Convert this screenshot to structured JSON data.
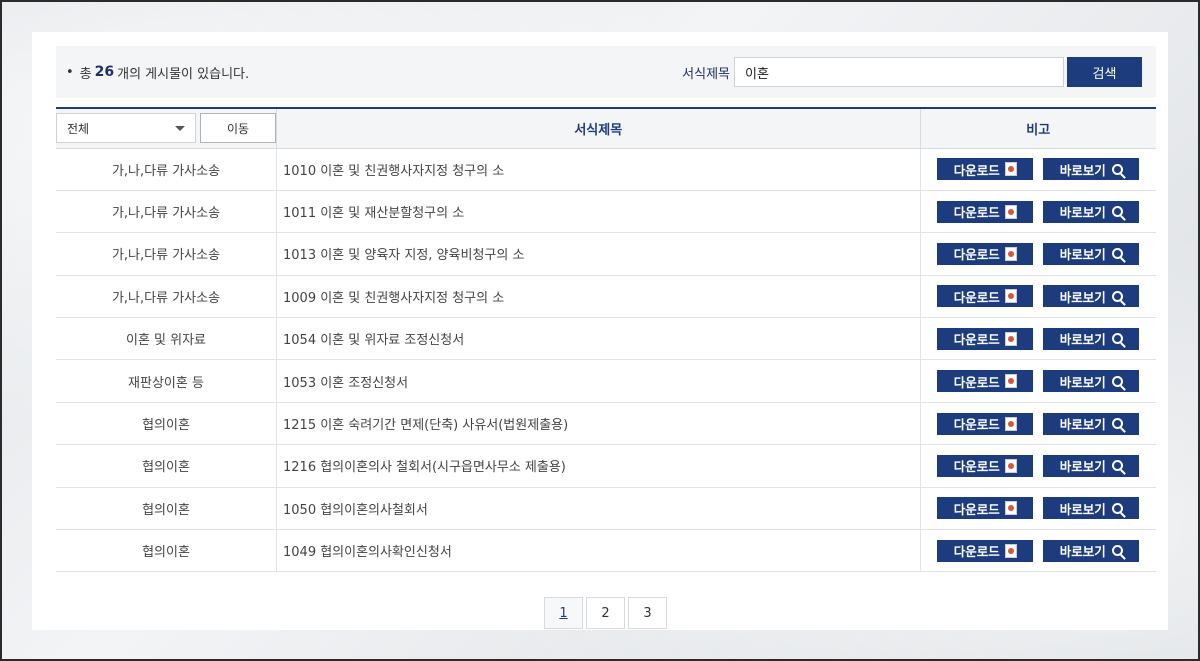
{
  "summary": {
    "prefix": "총",
    "count": "26",
    "suffix": "개의 게시물이 있습니다."
  },
  "search": {
    "label": "서식제목",
    "value": "이혼",
    "button": "검색"
  },
  "filter": {
    "selected": "전체",
    "move_button": "이동"
  },
  "columns": {
    "title": "서식제목",
    "note": "비고"
  },
  "buttons": {
    "download": "다운로드",
    "view": "바로보기"
  },
  "rows": [
    {
      "category": "가,나,다류 가사소송",
      "title": "1010 이혼 및 친권행사자지정 청구의 소"
    },
    {
      "category": "가,나,다류 가사소송",
      "title": "1011 이혼 및 재산분할청구의 소"
    },
    {
      "category": "가,나,다류 가사소송",
      "title": "1013 이혼 및 양육자 지정, 양육비청구의 소"
    },
    {
      "category": "가,나,다류 가사소송",
      "title": "1009 이혼 및 친권행사자지정 청구의 소"
    },
    {
      "category": "이혼 및 위자료",
      "title": "1054 이혼 및 위자료 조정신청서"
    },
    {
      "category": "재판상이혼 등",
      "title": "1053 이혼 조정신청서"
    },
    {
      "category": "협의이혼",
      "title": "1215 이혼 숙려기간 면제(단축) 사유서(법원제출용)"
    },
    {
      "category": "협의이혼",
      "title": "1216 협의이혼의사 철회서(시구읍면사무소 제출용)"
    },
    {
      "category": "협의이혼",
      "title": "1050 협의이혼의사철회서"
    },
    {
      "category": "협의이혼",
      "title": "1049 협의이혼의사확인신청서"
    }
  ],
  "pagination": {
    "pages": [
      "1",
      "2",
      "3"
    ],
    "current": "1"
  }
}
